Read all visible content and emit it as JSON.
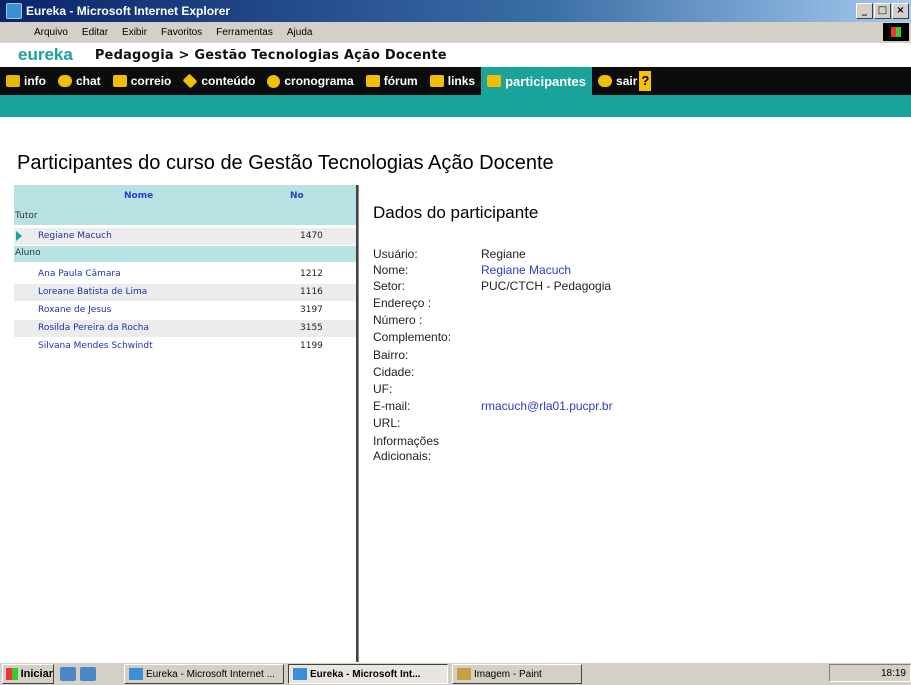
{
  "window": {
    "title": "Eureka - Microsoft Internet Explorer",
    "buttons": [
      "_",
      "□",
      "×"
    ]
  },
  "menu": [
    "Arquivo",
    "Editar",
    "Exibir",
    "Favoritos",
    "Ferramentas",
    "Ajuda"
  ],
  "app": {
    "logo": "eureka",
    "breadcrumb": "Pedagogia > Gestão Tecnologias Ação Docente"
  },
  "nav": [
    {
      "label": "info",
      "icon": "info-icon",
      "color": "#e6b800"
    },
    {
      "label": "chat",
      "icon": "chat-icon",
      "color": "#f0c000"
    },
    {
      "label": "correio",
      "icon": "mail-icon",
      "color": "#f0c000"
    },
    {
      "label": "conteúdo",
      "icon": "content-icon",
      "color": "#f0c000"
    },
    {
      "label": "cronograma",
      "icon": "clock-icon",
      "color": "#f0c000"
    },
    {
      "label": "fórum",
      "icon": "forum-icon",
      "color": "#f0c000"
    },
    {
      "label": "links",
      "icon": "links-icon",
      "color": "#f0c000"
    },
    {
      "label": "participantes",
      "icon": "participants-icon",
      "color": "#f0c000",
      "active": true
    },
    {
      "label": "sair",
      "icon": "exit-icon",
      "color": "#f0c000"
    },
    {
      "label": "?",
      "icon": "help-icon",
      "color": "#f0c000"
    }
  ],
  "page": {
    "title": "Participantes do curso de Gestão Tecnologias Ação Docente"
  },
  "list": {
    "col_name": "Nome",
    "col_no": "No",
    "groups": [
      {
        "label": "Tutor",
        "rows": [
          {
            "name": "Regiane Macuch",
            "no": "1470",
            "selected": true
          }
        ]
      },
      {
        "label": "Aluno",
        "rows": [
          {
            "name": "Ana Paula Câmara",
            "no": "1212"
          },
          {
            "name": "Loreane Batista de Lima",
            "no": "1116"
          },
          {
            "name": "Roxane de Jesus",
            "no": "3197"
          },
          {
            "name": "Rosilda Pereira da Rocha",
            "no": "3155"
          },
          {
            "name": "Silvana Mendes Schwindt",
            "no": "1199"
          }
        ]
      }
    ]
  },
  "details": {
    "title": "Dados do participante",
    "fields": [
      {
        "label": "Usuário:",
        "value": "Regiane"
      },
      {
        "label": "Nome:",
        "value": "Regiane Macuch",
        "link": true
      },
      {
        "label": "Setor:",
        "value": "PUC/CTCH - Pedagogia"
      },
      {
        "label": "Endereço :",
        "value": ""
      },
      {
        "label": "Número :",
        "value": ""
      },
      {
        "label": "Complemento:",
        "value": ""
      },
      {
        "label": "Bairro:",
        "value": ""
      },
      {
        "label": "Cidade:",
        "value": ""
      },
      {
        "label": "UF:",
        "value": ""
      },
      {
        "label": "E-mail:",
        "value": "rmacuch@rla01.pucpr.br",
        "link": true
      },
      {
        "label": "URL:",
        "value": ""
      },
      {
        "label": "Informações",
        "value": ""
      },
      {
        "label": "Adicionais:",
        "value": ""
      }
    ]
  },
  "taskbar": {
    "start": "Iniciar",
    "buttons": [
      {
        "label": "Eureka - Microsoft Internet ..."
      },
      {
        "label": "Eureka - Microsoft Int...",
        "active": true
      },
      {
        "label": "Imagem - Paint"
      }
    ],
    "clock": "18:19"
  }
}
